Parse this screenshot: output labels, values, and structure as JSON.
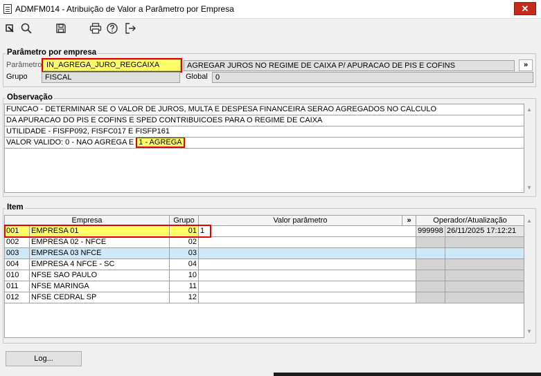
{
  "window": {
    "title": "ADMFM014 - Atribuição de Valor a Parâmetro por Empresa",
    "close_glyph": "✕"
  },
  "toolbar": {
    "icons": [
      "pin-icon",
      "search-icon",
      "save-icon",
      "print-icon",
      "help-icon",
      "exit-icon"
    ]
  },
  "parametro_section": {
    "legend": "Parâmetro por empresa",
    "parametro_label": "Parâmetro",
    "parametro_value": "IN_AGREGA_JURO_REGCAIXA",
    "parametro_description": "AGREGAR JUROS NO REGIME DE CAIXA P/ APURACAO DE PIS E COFINS",
    "expand_button": "»",
    "grupo_label": "Grupo",
    "grupo_value": "FISCAL",
    "global_label": "Global",
    "global_value": "0"
  },
  "observacao_section": {
    "legend": "Observação",
    "lines": [
      "FUNCAO - DETERMINAR SE O VALOR DE JUROS, MULTA E DESPESA FINANCEIRA SERAO AGREGADOS NO CALCULO",
      "DA APURACAO DO PIS E COFINS E SPED CONTRIBUICOES PARA O REGIME DE CAIXA",
      "UTILIDADE - FISFP092, FISFC017 E FISFP161"
    ],
    "line4_prefix": "VALOR VALIDO: 0 - NAO AGREGA E ",
    "line4_highlight": "1 - AGREGA"
  },
  "item_section": {
    "legend": "Item",
    "headers": {
      "empresa": "Empresa",
      "grupo": "Grupo",
      "valor": "Valor parâmetro",
      "expand": "»",
      "operador": "Operador/Atualização"
    },
    "rows": [
      {
        "code": "001",
        "name": "EMPRESA 01",
        "grupo": "01",
        "valor": "1",
        "operador": "999998",
        "data": "26/11/2025 17:12:21"
      },
      {
        "code": "002",
        "name": "EMPRESA 02 - NFCE",
        "grupo": "02",
        "valor": "",
        "operador": "",
        "data": ""
      },
      {
        "code": "003",
        "name": "EMPRESA 03 NFCE",
        "grupo": "03",
        "valor": "",
        "operador": "",
        "data": ""
      },
      {
        "code": "004",
        "name": "EMPRESA 4 NFCE - SC",
        "grupo": "04",
        "valor": "",
        "operador": "",
        "data": ""
      },
      {
        "code": "010",
        "name": "NFSE SAO PAULO",
        "grupo": "10",
        "valor": "",
        "operador": "",
        "data": ""
      },
      {
        "code": "011",
        "name": "NFSE MARINGA",
        "grupo": "11",
        "valor": "",
        "operador": "",
        "data": ""
      },
      {
        "code": "012",
        "name": "NFSE CEDRAL SP",
        "grupo": "12",
        "valor": "",
        "operador": "",
        "data": ""
      }
    ]
  },
  "footer": {
    "log_button": "Log..."
  },
  "colors": {
    "highlight_yellow": "#ffff66",
    "annotation_red": "#e00000",
    "selected_row": "#cde8f6",
    "close_red": "#c42b1c"
  }
}
